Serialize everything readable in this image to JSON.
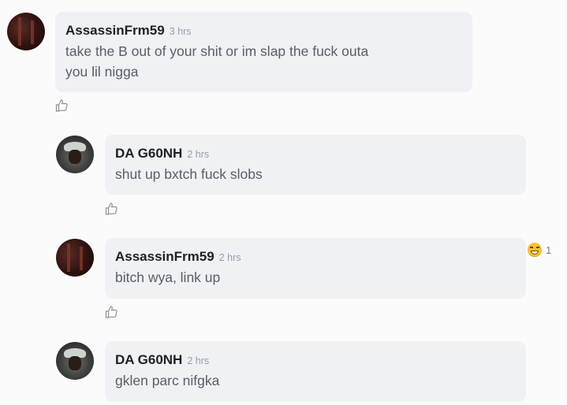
{
  "comments": [
    {
      "author": "AssassinFrm59",
      "time": "3 hrs",
      "text": "take the B out of your shit or im slap the fuck outa\nyou lil nigga",
      "avatar_icon": "avatar-red-photo-icon"
    },
    {
      "author": "DA G60NH",
      "time": "2 hrs",
      "text": "shut up bxtch fuck slobs",
      "avatar_icon": "avatar-hat-photo-icon"
    },
    {
      "author": "AssassinFrm59",
      "time": "2 hrs",
      "text": "bitch wya, link up",
      "avatar_icon": "avatar-red-photo-icon",
      "reaction": {
        "icon": "laughing-emoji-icon",
        "count": "1"
      }
    },
    {
      "author": "DA G60NH",
      "time": "2 hrs",
      "text": "gklen parc nifgka",
      "avatar_icon": "avatar-hat-photo-icon"
    }
  ],
  "like_icon": "thumbs-up-icon",
  "colors": {
    "bubble": "#f0f1f4",
    "background": "#fbfbfc",
    "name": "#1f2024",
    "text": "#5a5d63",
    "time": "#9a9da4"
  }
}
